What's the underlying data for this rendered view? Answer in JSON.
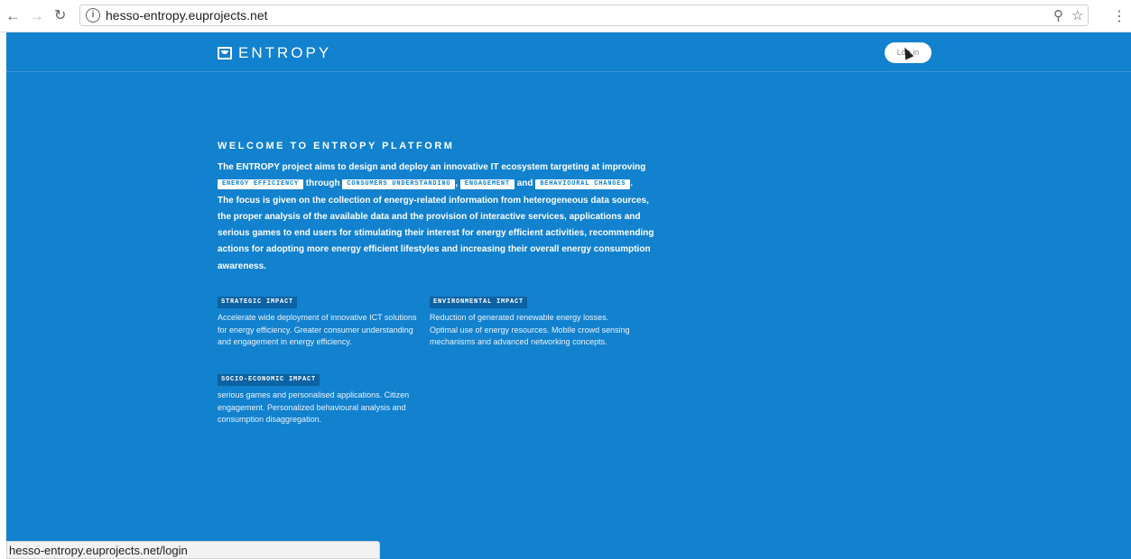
{
  "browser": {
    "back_icon": "arrow-left-icon",
    "forward_icon": "arrow-right-icon",
    "reload_icon": "reload-icon",
    "url": "hesso-entropy.euprojects.net",
    "zoom_icon": "zoom-icon",
    "bookmark_icon": "star-icon",
    "menu_icon": "kebab-menu-icon"
  },
  "header": {
    "logo_text": "ENTROPY",
    "login_label": "Log in"
  },
  "welcome": {
    "title": "WELCOME TO ENTROPY PLATFORM",
    "intro_start": "The ENTROPY project aims to design and deploy an innovative IT ecosystem targeting at improving",
    "chip_energy_efficiency": "ENERGY EFFICIENCY",
    "word_through": "through",
    "chip_consumers": "CONSUMERS UNDERSTANDING",
    "comma": ",",
    "chip_engagement": "ENGAGEMENT",
    "word_and": "and",
    "chip_behavioural": "BEHAVIOURAL CHANGES",
    "period": ".",
    "intro_end": "The focus is given on the collection of energy-related information from heterogeneous data sources, the proper analysis of the available data and the provision of interactive services, applications and serious games to end users for stimulating their interest for energy efficient activities, recommending actions for adopting more energy efficient lifestyles and increasing their overall energy consumption awareness."
  },
  "impacts": [
    {
      "label": "STRATEGIC IMPACT",
      "text": "Accelerate wide deployment of innovative ICT solutions for energy efficiency. Greater consumer understanding and engagement in energy efficiency."
    },
    {
      "label": "ENVIRONMENTAL IMPACT",
      "text": "Reduction of generated renewable energy losses. Optimal use of energy resources. Mobile crowd sensing mechanisms and advanced networking concepts."
    },
    {
      "label": "SOCIO-ECONOMIC IMPACT",
      "text": "serious games and personalised applications. Citizen engagement. Personalized behavioural analysis and consumption disaggregation."
    }
  ],
  "status_bar": {
    "text": "hesso-entropy.euprojects.net/login"
  },
  "colors": {
    "page_background": "#1281ce",
    "chip_dark": "#0c62a2"
  }
}
